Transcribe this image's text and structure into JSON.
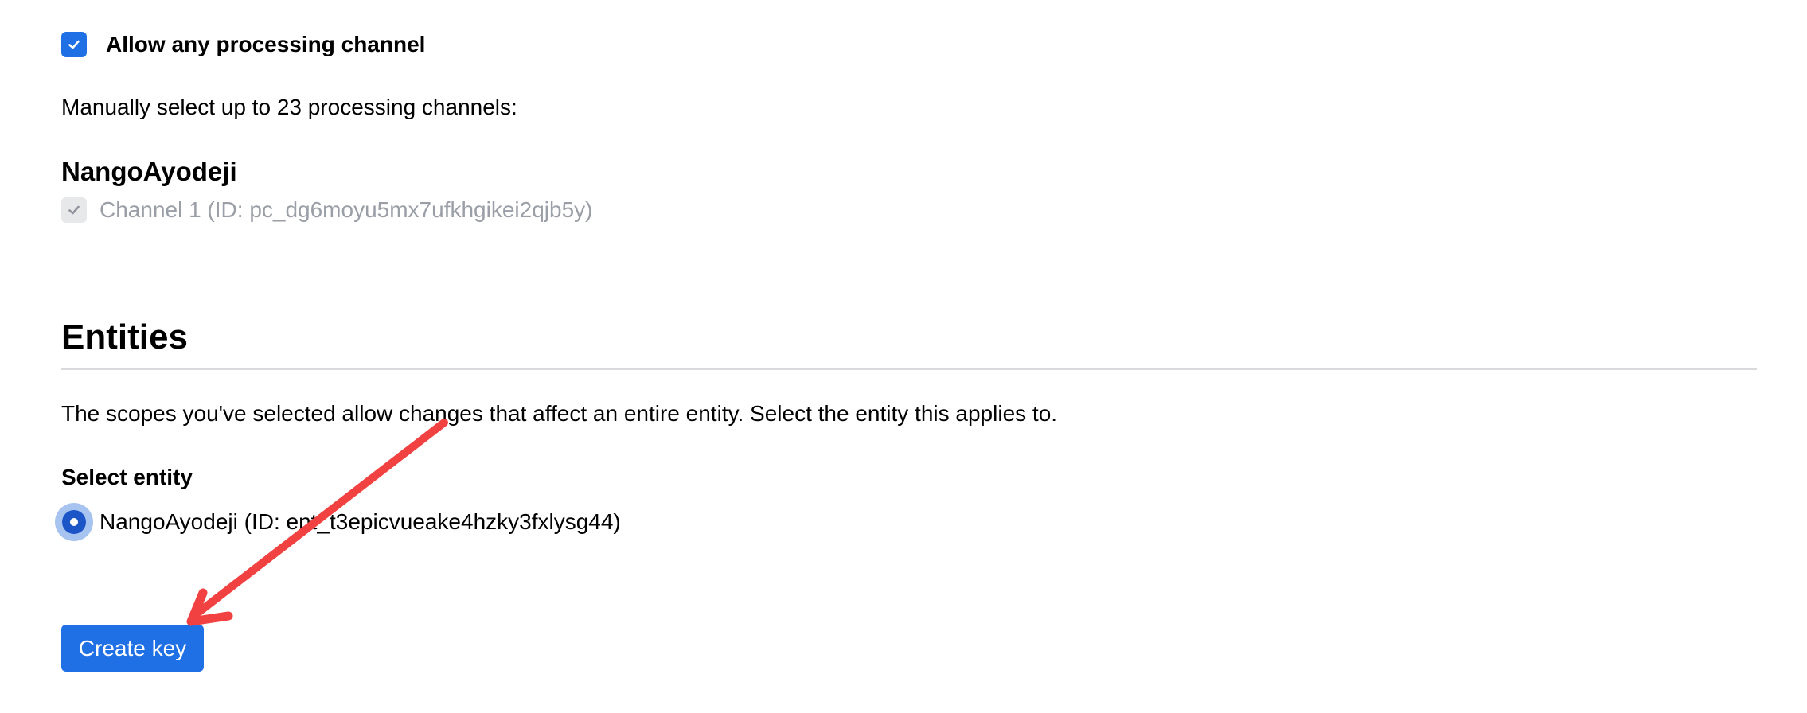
{
  "processing_channels": {
    "allow_any_label": "Allow any processing channel",
    "allow_any_checked": true,
    "manual_select_text": "Manually select up to 23 processing channels:",
    "groups": [
      {
        "name": "NangoAyodeji",
        "channels": [
          {
            "label": "Channel 1 (ID: pc_dg6moyu5mx7ufkhgikei2qjb5y)",
            "checked": true,
            "disabled": true
          }
        ]
      }
    ]
  },
  "entities": {
    "title": "Entities",
    "description": "The scopes you've selected allow changes that affect an entire entity. Select the entity this applies to.",
    "select_label": "Select entity",
    "options": [
      {
        "label": "NangoAyodeji (ID: ent_t3epicvueake4hzky3fxlysg44)",
        "selected": true
      }
    ]
  },
  "actions": {
    "create_key_label": "Create key"
  },
  "colors": {
    "primary": "#1f6fe5",
    "radio_ring": "#a7c4f0",
    "annotation_arrow": "#f24141",
    "disabled_text": "#9a9ea6"
  },
  "icons": {
    "checkmark": "check-icon",
    "annotation": "arrow-icon"
  }
}
